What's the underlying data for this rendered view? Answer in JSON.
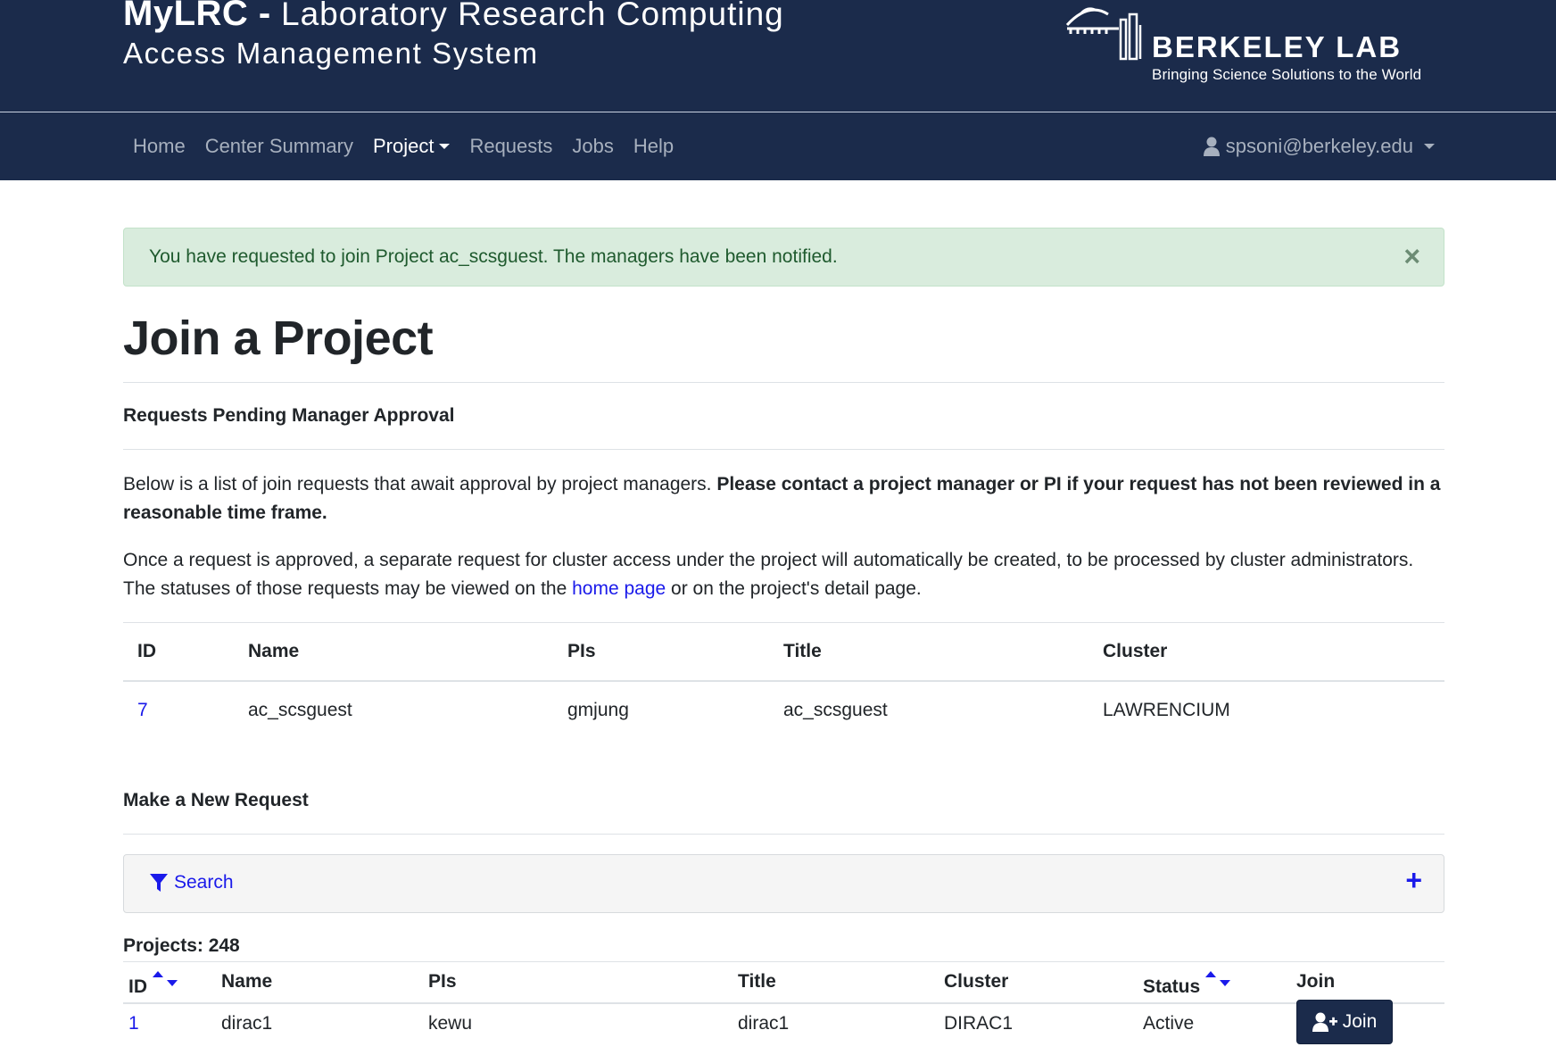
{
  "header": {
    "app_name": "MyLRC -",
    "subtitle_line1": "Laboratory Research Computing",
    "subtitle_line2": "Access Management System",
    "org_name": "BERKELEY LAB",
    "org_tagline": "Bringing Science Solutions to the World"
  },
  "nav": {
    "items": [
      {
        "label": "Home"
      },
      {
        "label": "Center Summary"
      },
      {
        "label": "Project"
      },
      {
        "label": "Requests"
      },
      {
        "label": "Jobs"
      },
      {
        "label": "Help"
      }
    ],
    "user": "spsoni@berkeley.edu"
  },
  "alert": {
    "message": "You have requested to join Project ac_scsguest. The managers have been notified.",
    "close": "×"
  },
  "page": {
    "title": "Join a Project"
  },
  "pending": {
    "heading": "Requests Pending Manager Approval",
    "para1_text": "Below is a list of join requests that await approval by project managers. ",
    "para1_bold": "Please contact a project manager or PI if your request has not been reviewed in a reasonable time frame.",
    "para2_text_before": "Once a request is approved, a separate request for cluster access under the project will automatically be created, to be processed by cluster administrators. The statuses of those requests may be viewed on the ",
    "para2_link": "home page",
    "para2_text_after": " or on the project's detail page.",
    "columns": [
      "ID",
      "Name",
      "PIs",
      "Title",
      "Cluster"
    ],
    "rows": [
      {
        "id": "7",
        "name": "ac_scsguest",
        "pis": "gmjung",
        "title": "ac_scsguest",
        "cluster": "LAWRENCIUM"
      }
    ]
  },
  "new_request": {
    "heading": "Make a New Request",
    "search_label": "Search",
    "expand": "+",
    "count_label": "Projects: 248",
    "columns": [
      "ID",
      "Name",
      "PIs",
      "Title",
      "Cluster",
      "Status",
      "Join"
    ],
    "rows": [
      {
        "id": "1",
        "name": "dirac1",
        "pis": "kewu",
        "title": "dirac1",
        "cluster": "DIRAC1",
        "status": "Active",
        "join_label": "Join"
      }
    ]
  },
  "colors": {
    "navy": "#1b2b4b",
    "link_blue": "#1a1aea",
    "alert_bg": "#d9ecdd",
    "alert_text": "#1f5a2e"
  }
}
